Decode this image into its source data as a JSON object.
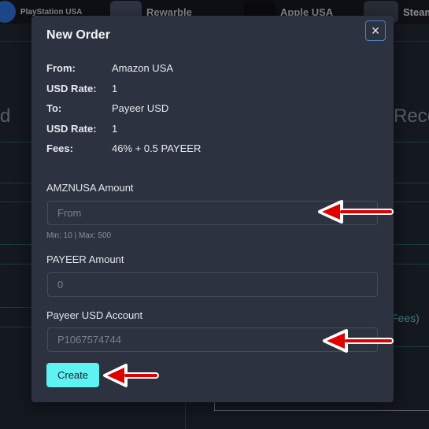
{
  "background": {
    "tiles": [
      "PlayStation USA",
      "Rewarble",
      "Apple USA",
      "Steam"
    ],
    "left_text": "d",
    "right_text": "Rece",
    "fees_text": "Fees)"
  },
  "modal": {
    "title": "New Order",
    "close_glyph": "×",
    "info": [
      {
        "label": "From:",
        "value": "Amazon USA"
      },
      {
        "label": "USD Rate:",
        "value": "1"
      },
      {
        "label": "To:",
        "value": "Payeer USD"
      },
      {
        "label": "USD Rate:",
        "value": "1"
      },
      {
        "label": "Fees:",
        "value": "46% + 0.5 PAYEER"
      }
    ],
    "amount_label": "AMZNUSA Amount",
    "amount_placeholder": "From",
    "amount_hint": "Min: 10 | Max: 500",
    "payeer_amount_label": "PAYEER Amount",
    "payeer_amount_placeholder": "0",
    "account_label": "Payeer USD Account",
    "account_placeholder": "P1067574744",
    "create_label": "Create"
  },
  "colors": {
    "accent": "#5ff2f2",
    "annotation": "#e00000",
    "panel": "#2c3240"
  },
  "icons": {
    "close": "close-icon",
    "arrow": "red-arrow-icon"
  }
}
